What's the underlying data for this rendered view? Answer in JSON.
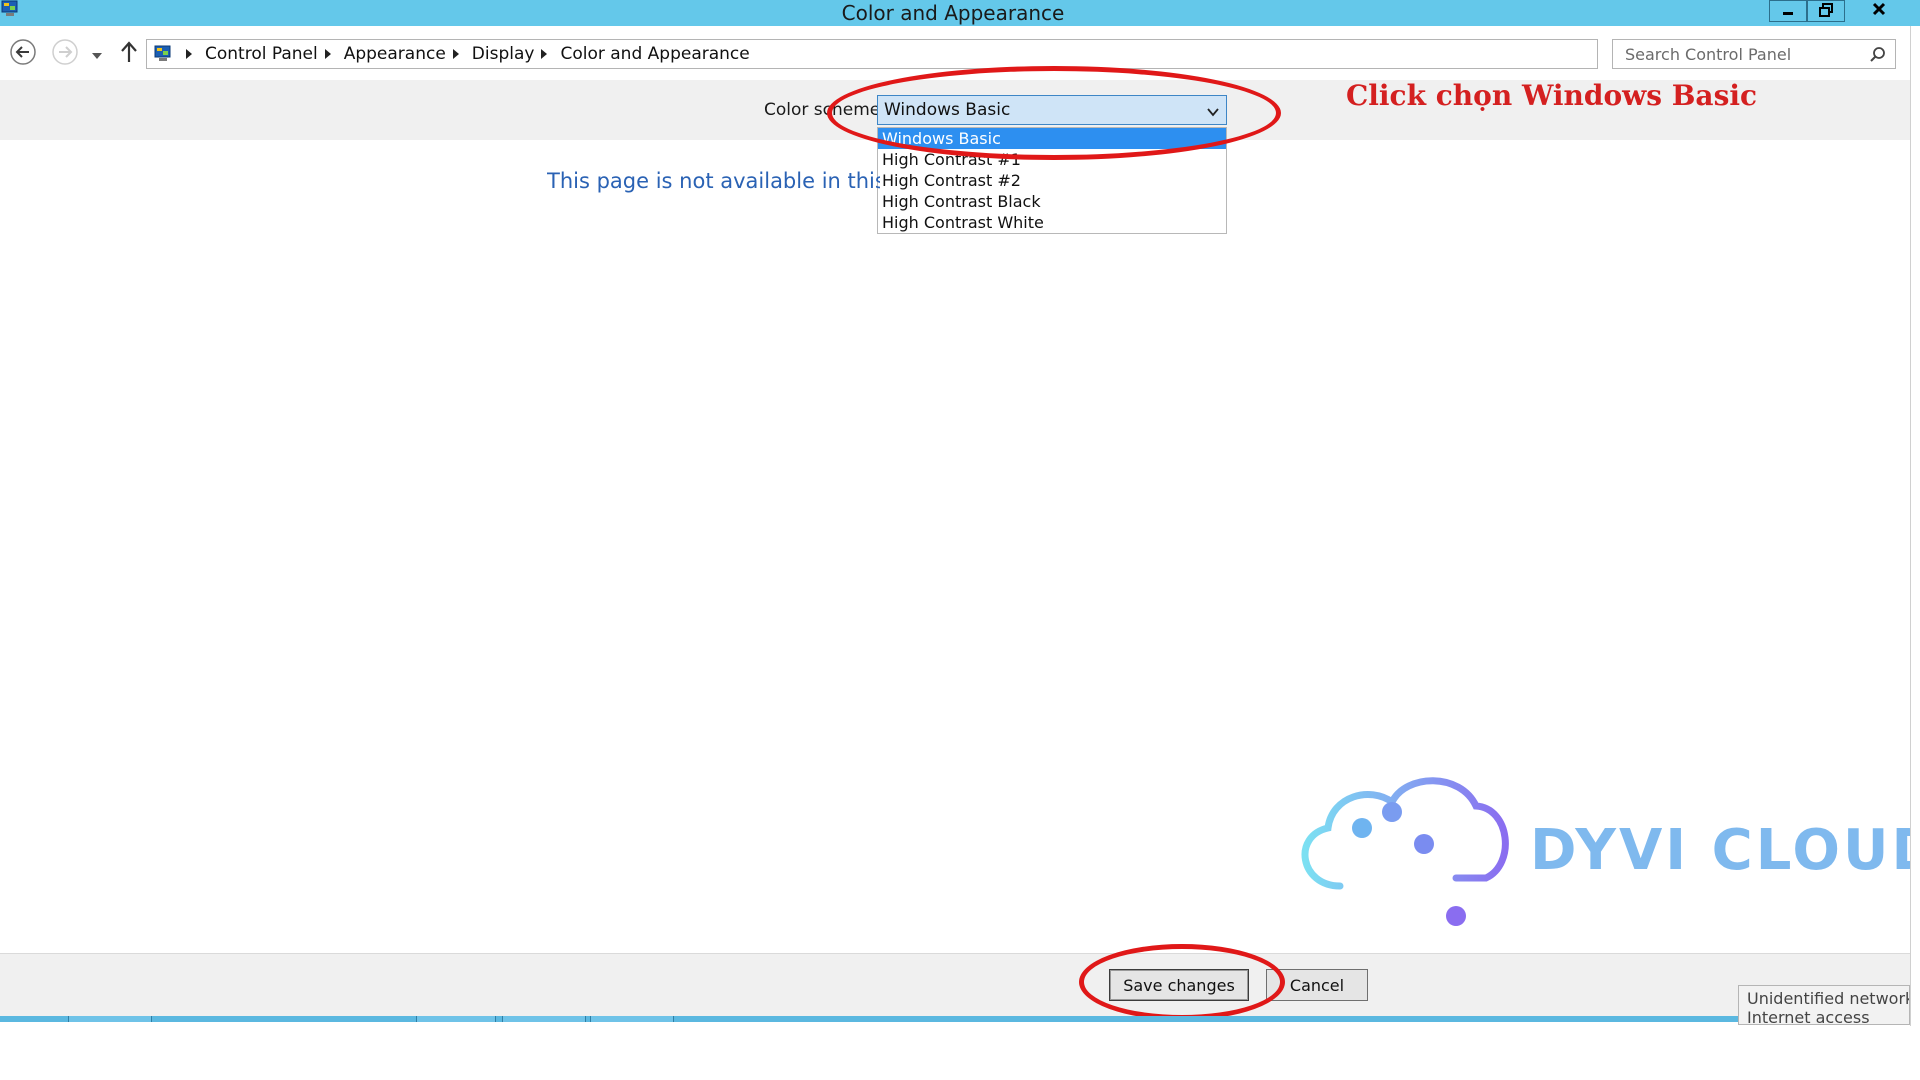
{
  "window": {
    "title": "Color and Appearance",
    "app_icon": "control-panel-icon",
    "controls": [
      "minimize-icon",
      "restore-icon",
      "close-icon"
    ]
  },
  "navigation": {
    "icons": [
      "back-arrow-icon",
      "forward-arrow-icon",
      "recent-pages-icon",
      "up-arrow-icon"
    ],
    "breadcrumb": [
      "Control Panel",
      "Appearance",
      "Display",
      "Color and Appearance"
    ],
    "search_placeholder": "Search Control Panel"
  },
  "scheme": {
    "label": "Color scheme:",
    "selected": "Windows Basic",
    "options": [
      "Windows Basic",
      "High Contrast #1",
      "High Contrast #2",
      "High Contrast Black",
      "High Contrast White"
    ]
  },
  "message": "This page is not available in this edition of Windows",
  "annotation": "Click chọn Windows Basic",
  "logo": {
    "text": "DYVI CLOUD",
    "icon": "cloud-circuit-icon"
  },
  "buttons": {
    "save": "Save changes",
    "cancel": "Cancel"
  },
  "network": {
    "line1": "Unidentified network",
    "line2": "Internet access"
  },
  "colors": {
    "titlebar": "#64c8ea",
    "annotation_red": "#d42020",
    "selection_blue": "#2d8ff0",
    "message_blue": "#2a62b4"
  }
}
